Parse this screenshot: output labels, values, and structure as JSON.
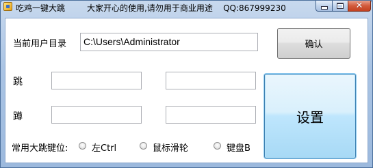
{
  "window": {
    "title": "吃鸡一键大跳",
    "note": "大家开心的使用,请勿用于商业用途    QQ:867999230"
  },
  "form": {
    "user_dir_label": "当前用户目录",
    "user_dir_value": "C:\\Users\\Administrator",
    "confirm_label": "确认",
    "jump_label": "跳",
    "crouch_label": "蹲",
    "jump_field_1": "",
    "jump_field_2": "",
    "crouch_field_1": "",
    "crouch_field_2": "",
    "setup_label": "设置",
    "hotkey_label": "常用大跳键位:",
    "options": [
      "左Ctrl",
      "鼠标滑轮",
      "键盘B"
    ]
  },
  "icons": {
    "app": "app-icon",
    "minimize": "minimize-icon",
    "maximize": "maximize-icon",
    "close": "close-icon"
  },
  "colors": {
    "title_bar": "#aac4e4",
    "close_button": "#d25a3c",
    "setup_button_highlight": "#bee6fd"
  }
}
